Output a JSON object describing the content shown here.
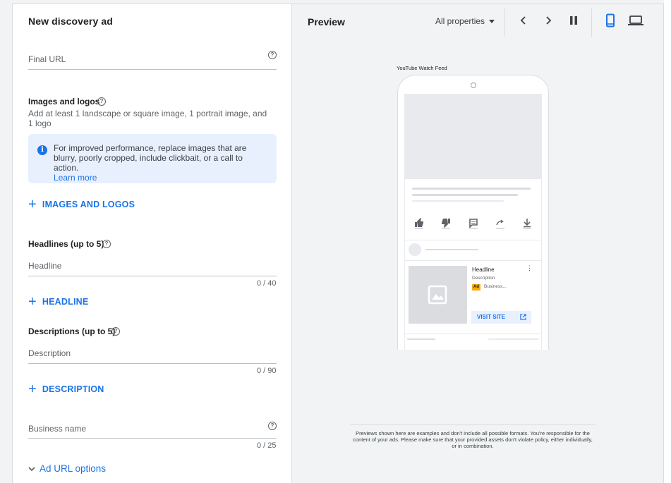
{
  "editor": {
    "title": "New discovery ad",
    "final_url": {
      "placeholder": "Final URL"
    },
    "images": {
      "title": "Images and logos",
      "subtitle": "Add at least 1 landscape or square image, 1 portrait image, and 1 logo",
      "info_text": "For improved performance, replace images that are blurry, poorly cropped, include clickbait, or a call to action.",
      "info_link": "Learn more",
      "add_label": "IMAGES AND LOGOS"
    },
    "headlines": {
      "title": "Headlines (up to 5)",
      "placeholder": "Headline",
      "counter": "0 / 40",
      "add_label": "HEADLINE"
    },
    "descriptions": {
      "title": "Descriptions (up to 5)",
      "placeholder": "Description",
      "counter": "0 / 90",
      "add_label": "DESCRIPTION"
    },
    "business": {
      "placeholder": "Business name",
      "counter": "0 / 25"
    },
    "url_options_label": "Ad URL options"
  },
  "preview": {
    "title": "Preview",
    "properties_dropdown": "All properties",
    "feed_label": "YouTube Watch Feed",
    "ad": {
      "headline": "Headline",
      "description": "Description",
      "badge": "Ad",
      "business": "Business...",
      "cta": "VISIT SITE"
    },
    "disclaimer": "Previews shown here are examples and don't include all possible formats. You're responsible for the content of your ads. Please make sure that your provided assets don't violate policy, either individually, or in combination."
  },
  "icons": [
    "help-icon",
    "info-icon",
    "add-icon",
    "chevron-left-icon",
    "chevron-right-icon",
    "pause-icon",
    "mobile-icon",
    "laptop-icon",
    "like-icon",
    "dislike-icon",
    "comment-icon",
    "share-icon",
    "download-icon",
    "image-placeholder-icon",
    "more-vert-icon",
    "open-in-new-icon",
    "chevron-down-icon"
  ],
  "colors": {
    "accent": "#1a73e8",
    "info_bg": "#e8f0fe",
    "ad_badge": "#f9ab00"
  }
}
